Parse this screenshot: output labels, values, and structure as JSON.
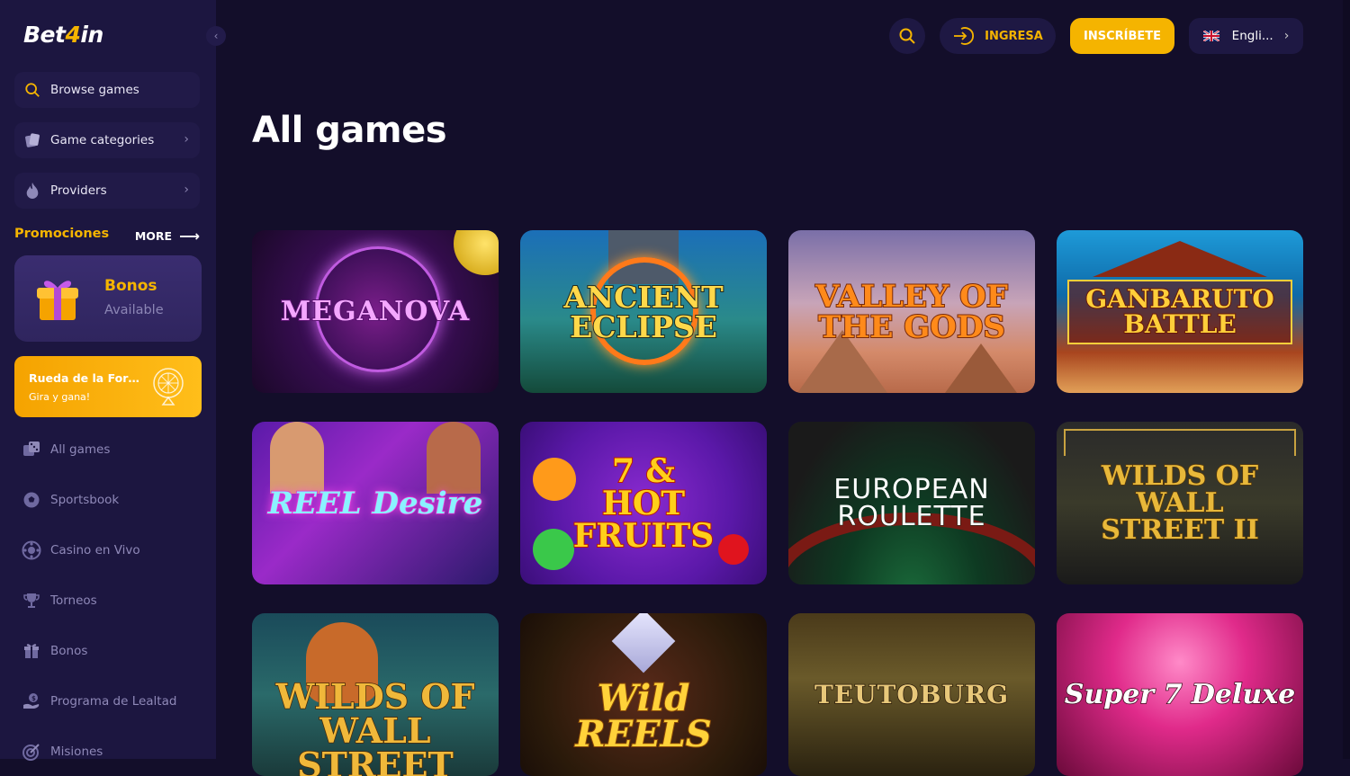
{
  "brand": {
    "logo_part1": "Bet",
    "logo_part2": "4",
    "logo_part3": "in"
  },
  "sidebar": {
    "browse_label": "Browse games",
    "categories_label": "Game categories",
    "providers_label": "Providers",
    "promotions_title": "Promociones",
    "more_label": "MORE",
    "bonos_title": "Bonos",
    "bonos_sub": "Available",
    "rueda_title": "Rueda de la Fortuna",
    "rueda_sub": "Gira y gana!",
    "nav": [
      {
        "label": "All games",
        "icon": "dice-icon"
      },
      {
        "label": "Sportsbook",
        "icon": "ball-icon"
      },
      {
        "label": "Casino en Vivo",
        "icon": "chip-icon"
      },
      {
        "label": "Torneos",
        "icon": "trophy-icon"
      },
      {
        "label": "Bonos",
        "icon": "gift-icon"
      },
      {
        "label": "Programa de Lealtad",
        "icon": "loyalty-icon"
      },
      {
        "label": "Misiones",
        "icon": "target-icon"
      }
    ]
  },
  "topbar": {
    "login_label": "INGRESA",
    "signup_label": "INSCRÍBETE",
    "language_label": "Engli..."
  },
  "main": {
    "title": "All games",
    "games": [
      {
        "name": "MEGANOVA"
      },
      {
        "name": "ANCIENT ECLIPSE"
      },
      {
        "name": "VALLEY OF THE GODS"
      },
      {
        "name": "GANBARUTO BATTLE"
      },
      {
        "name": "REEL Desire"
      },
      {
        "name": "7 & HOT FRUITS"
      },
      {
        "name": "EUROPEAN ROULETTE"
      },
      {
        "name": "WILDS OF WALL STREET II"
      },
      {
        "name": "WILDS OF WALL STREET"
      },
      {
        "name": "Wild REELS"
      },
      {
        "name": "TEUTOBURG"
      },
      {
        "name": "Super 7 Deluxe"
      }
    ]
  },
  "colors": {
    "accent": "#f5b400",
    "background": "#130e2a",
    "sidebar": "#1c1640"
  }
}
